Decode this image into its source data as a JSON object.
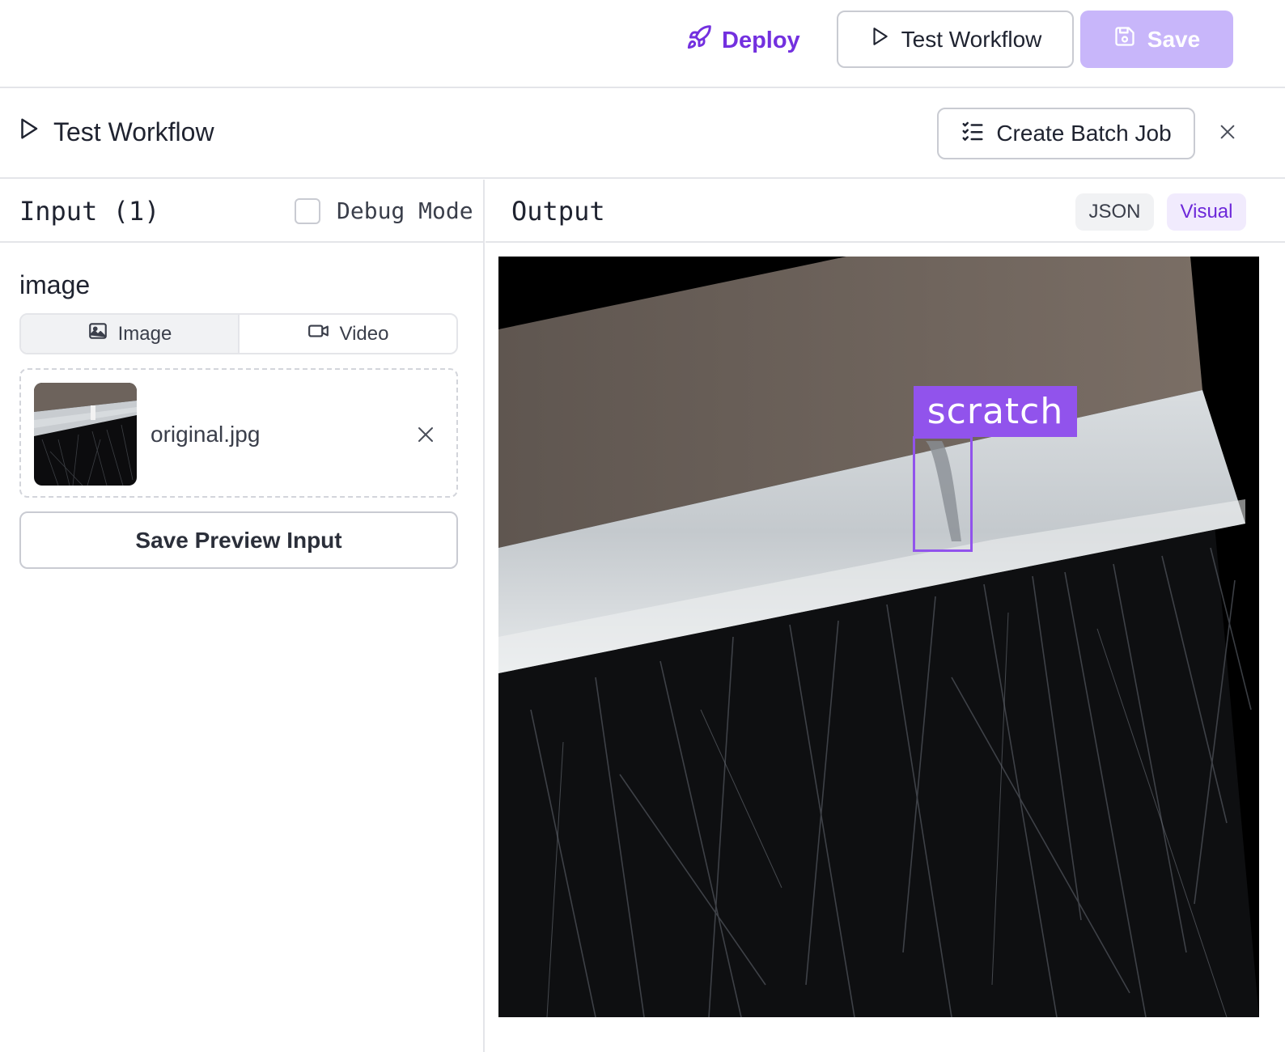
{
  "topbar": {
    "deploy_label": "Deploy",
    "test_label": "Test Workflow",
    "save_label": "Save"
  },
  "panel": {
    "title": "Test Workflow",
    "batch_label": "Create Batch Job"
  },
  "input": {
    "title": "Input (1)",
    "debug_label": "Debug Mode",
    "debug_checked": false,
    "field_label": "image",
    "media_tabs": [
      {
        "label": "Image",
        "icon": "image-icon",
        "active": true
      },
      {
        "label": "Video",
        "icon": "video-icon",
        "active": false
      }
    ],
    "file_name": "original.jpg",
    "save_preview_label": "Save Preview Input"
  },
  "output": {
    "title": "Output",
    "tabs": [
      {
        "label": "JSON",
        "active": false
      },
      {
        "label": "Visual",
        "active": true
      }
    ],
    "detection_label": "scratch"
  },
  "colors": {
    "accent": "#7330df",
    "save_disabled": "#c8b6fa",
    "detection": "#9153ec",
    "border": "#e4e5e9"
  }
}
